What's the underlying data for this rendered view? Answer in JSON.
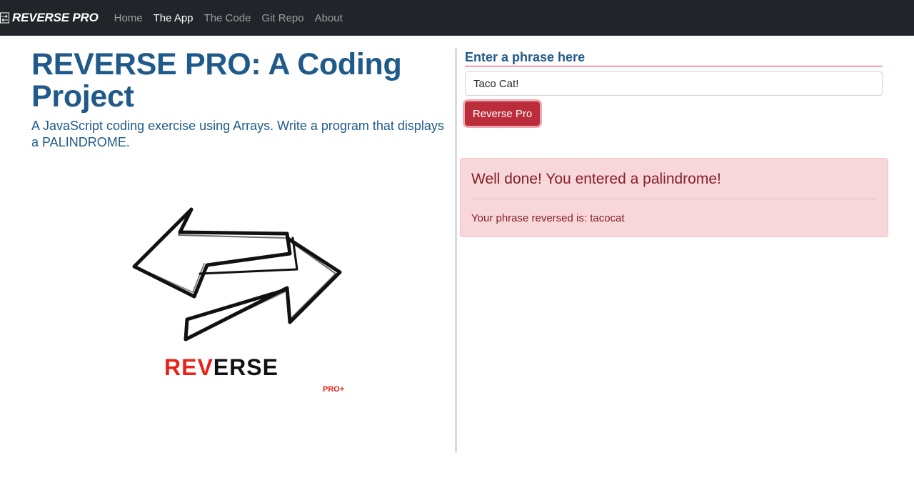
{
  "navbar": {
    "brand": "REVERSE PRO",
    "items": [
      {
        "label": "Home",
        "active": false
      },
      {
        "label": "The App",
        "active": true
      },
      {
        "label": "The Code",
        "active": false
      },
      {
        "label": "Git Repo",
        "active": false
      },
      {
        "label": "About",
        "active": false
      }
    ]
  },
  "intro": {
    "title": "REVERSE PRO: A Coding Project",
    "lead": "A JavaScript coding exercise using Arrays. Write a program that displays a PALINDROME."
  },
  "logo": {
    "word_red": "REV",
    "word_black": "ERSE",
    "tag": "PRO+"
  },
  "form": {
    "heading": "Enter a phrase here",
    "input_value": "Taco Cat!",
    "button_label": "Reverse Pro"
  },
  "result": {
    "heading": "Well done! You entered a palindrome!",
    "message": "Your phrase reversed is: tacocat"
  },
  "colors": {
    "navbar": "#212529",
    "title": "#1f5a8a",
    "button": "#bb2d3b",
    "alert_bg": "#f8d7da",
    "alert_text": "#842029",
    "logo_red": "#e8211a"
  }
}
